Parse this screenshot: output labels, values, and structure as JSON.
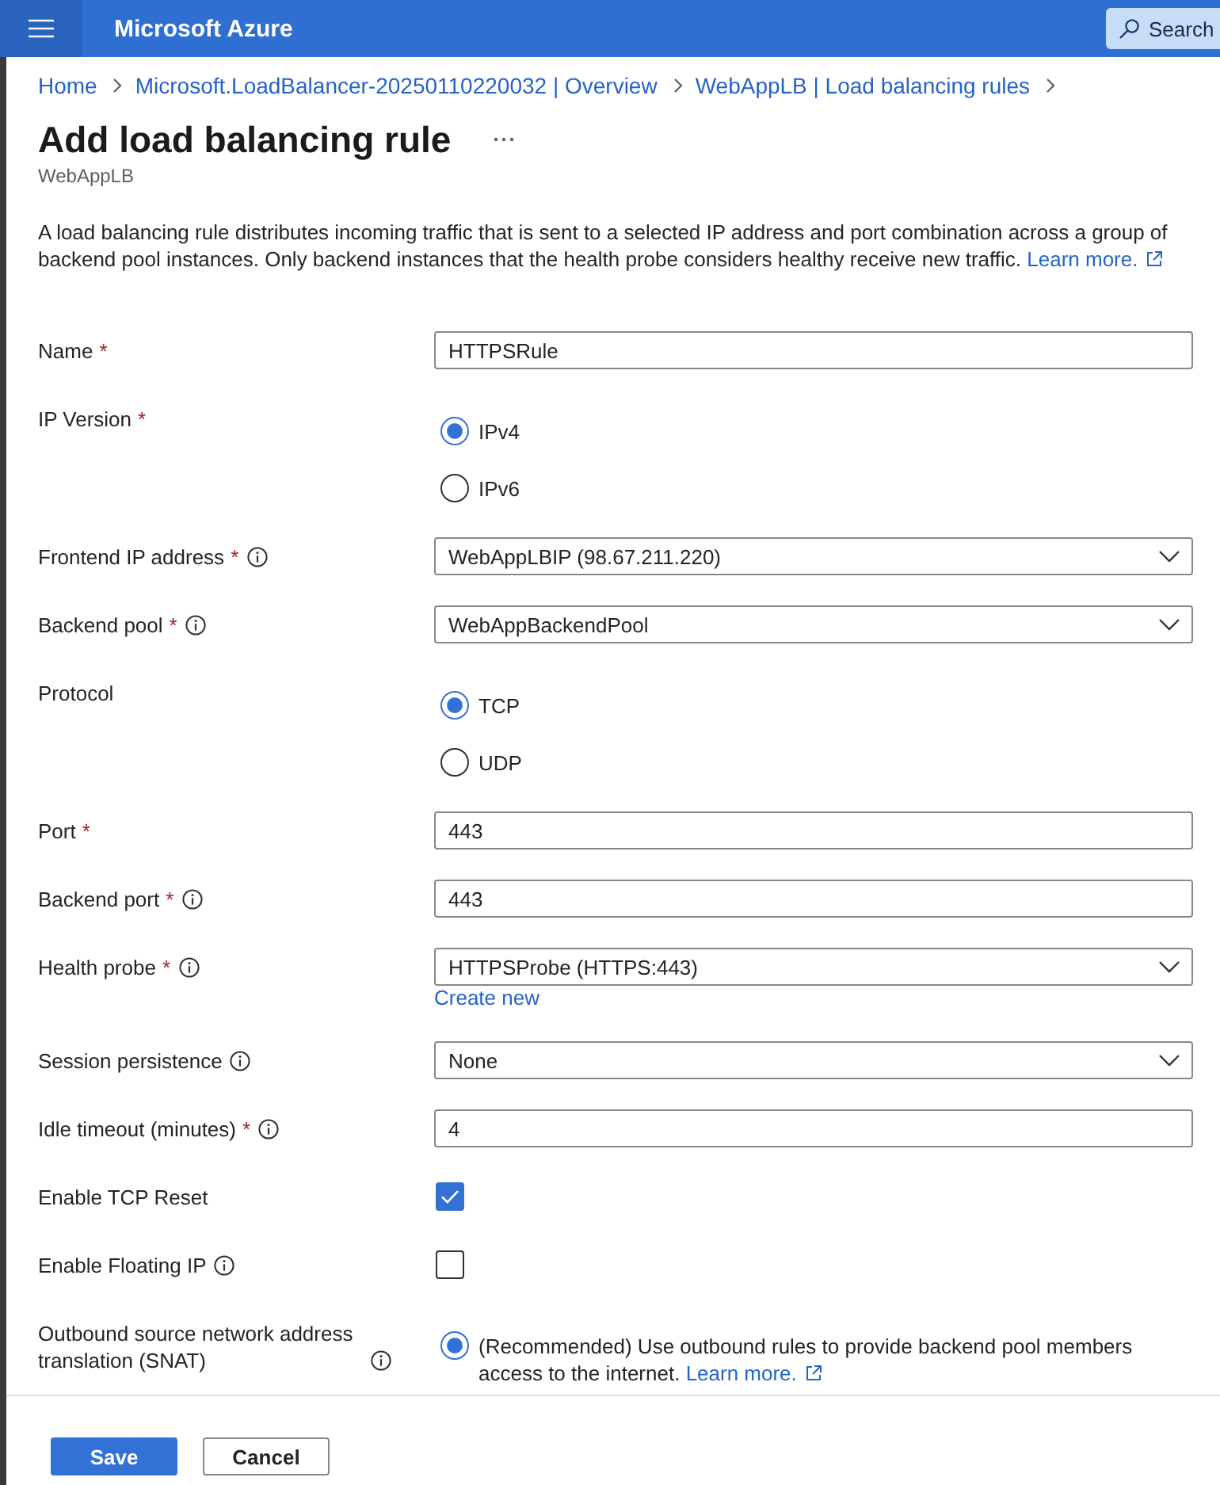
{
  "top_bar": {
    "title": "Microsoft Azure",
    "search": {
      "placeholder": "Search"
    }
  },
  "breadcrumb": [
    {
      "label": "Home"
    },
    {
      "label": "Microsoft.LoadBalancer-20250110220032 | Overview"
    },
    {
      "label": "WebAppLB | Load balancing rules"
    }
  ],
  "page": {
    "title": "Add load balancing rule",
    "subtitle": "WebAppLB"
  },
  "description": {
    "text": "A load balancing rule distributes incoming traffic that is sent to a selected IP address and port combination across a group of backend pool instances. Only backend instances that the health probe considers healthy receive new traffic.",
    "link": "Learn more."
  },
  "fields": [
    {
      "kind": "text",
      "label": "Name",
      "required_mark": "*",
      "info": false,
      "value": "HTTPSRule"
    },
    {
      "kind": "radio",
      "label": "IP Version",
      "required_mark": "*",
      "info": false,
      "options": [
        {
          "label": "IPv4",
          "selected": true
        },
        {
          "label": "IPv6",
          "selected": false
        }
      ]
    },
    {
      "kind": "dropdown",
      "label": "Frontend IP address",
      "required_mark": "*",
      "info": true,
      "value": "WebAppLBIP (98.67.211.220)"
    },
    {
      "kind": "dropdown",
      "label": "Backend pool",
      "required_mark": "*",
      "info": true,
      "value": "WebAppBackendPool"
    },
    {
      "kind": "radio",
      "label": "Protocol",
      "info": false,
      "options": [
        {
          "label": "TCP",
          "selected": true
        },
        {
          "label": "UDP",
          "selected": false
        }
      ]
    },
    {
      "kind": "text",
      "label": "Port",
      "required_mark": "*",
      "info": false,
      "value": "443"
    },
    {
      "kind": "text",
      "label": "Backend port",
      "required_mark": "*",
      "info": true,
      "value": "443"
    },
    {
      "kind": "dropdown",
      "label": "Health probe",
      "required_mark": "*",
      "info": true,
      "value": "HTTPSProbe (HTTPS:443)",
      "link": "Create new"
    },
    {
      "kind": "dropdown",
      "label": "Session persistence",
      "info": true,
      "value": "None"
    },
    {
      "kind": "text",
      "label": "Idle timeout (minutes)",
      "required_mark": "*",
      "info": true,
      "value": "4"
    },
    {
      "kind": "checkbox",
      "label": "Enable TCP Reset",
      "info": false,
      "checked": true
    },
    {
      "kind": "checkbox",
      "label": "Enable Floating IP",
      "info": true,
      "checked": false
    },
    {
      "kind": "radio",
      "label": "Outbound source network address translation (SNAT)",
      "info": true,
      "options": [
        {
          "label": "(Recommended) Use outbound rules to provide backend pool members access to the internet.",
          "link": "Learn more.",
          "selected": true
        }
      ]
    }
  ],
  "footer": {
    "buttons": [
      {
        "label": "Save",
        "kind": "primary"
      },
      {
        "label": "Cancel",
        "kind": "secondary"
      }
    ]
  }
}
